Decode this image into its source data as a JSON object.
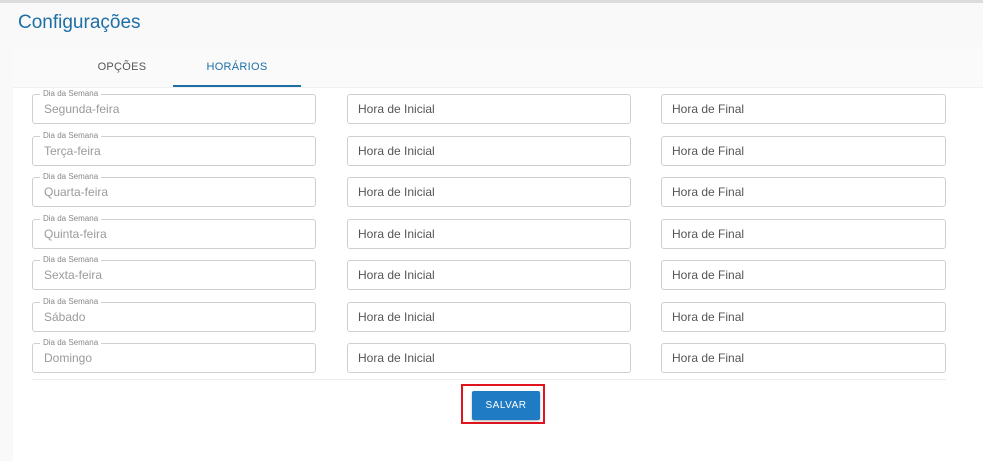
{
  "header": {
    "title": "Configurações"
  },
  "tabs": [
    {
      "label": "OPÇÕES",
      "active": false
    },
    {
      "label": "HORÁRIOS",
      "active": true
    }
  ],
  "schedule": {
    "day_legend": "Dia da Semana",
    "start_placeholder": "Hora de Inicial",
    "end_placeholder": "Hora de Final",
    "days": [
      "Segunda-feira",
      "Terça-feira",
      "Quarta-feira",
      "Quinta-feira",
      "Sexta-feira",
      "Sábado",
      "Domingo"
    ]
  },
  "actions": {
    "save_label": "SALVAR"
  },
  "colors": {
    "accent": "#1e6fa6",
    "button": "#1f7bc4",
    "highlight": "#e0141e"
  }
}
